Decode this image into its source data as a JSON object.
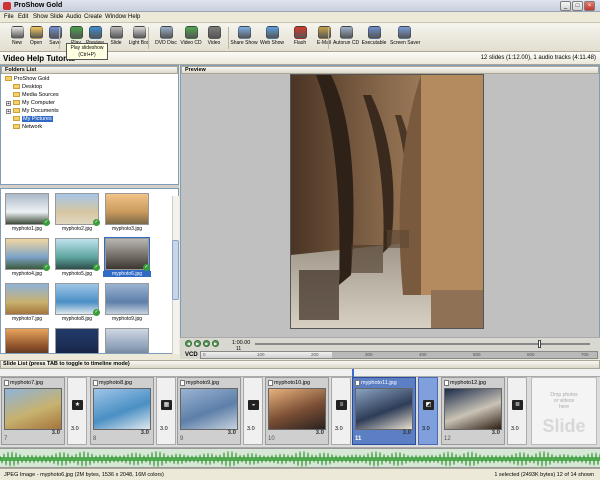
{
  "window": {
    "title": "ProShow Gold"
  },
  "menu": [
    "File",
    "Edit",
    "Show",
    "Slide",
    "Audio",
    "Create",
    "Window",
    "Help"
  ],
  "toolbar": [
    {
      "label": "New",
      "icon": "new-icon",
      "color": "#e8e8e8"
    },
    {
      "label": "Open",
      "icon": "open-icon",
      "color": "#f1c75b"
    },
    {
      "label": "Save",
      "icon": "save-icon",
      "color": "#6f8fcf"
    },
    {
      "label": "Play",
      "icon": "play-icon",
      "color": "#4aa14a"
    },
    {
      "label": "Preview",
      "icon": "preview-icon",
      "color": "#3d8ed1"
    },
    {
      "label": "Slide",
      "icon": "slide-icon",
      "color": "#bbbbbb"
    },
    {
      "label": "Light Box",
      "icon": "lightbox-icon",
      "color": "#d9d9d9"
    },
    {
      "label": "DVD Disc",
      "icon": "dvd-icon",
      "color": "#9cb0c8"
    },
    {
      "label": "Video CD",
      "icon": "vcd-icon",
      "color": "#4fa84f"
    },
    {
      "label": "Video",
      "icon": "video-icon",
      "color": "#7c7c7c"
    },
    {
      "label": "Share Show",
      "icon": "share-icon",
      "color": "#7fb0e6"
    },
    {
      "label": "Web Show",
      "icon": "web-icon",
      "color": "#5da0e0"
    },
    {
      "label": "Flash",
      "icon": "flash-icon",
      "color": "#d23b2b"
    },
    {
      "label": "E-Mail",
      "icon": "email-icon",
      "color": "#c8a24a"
    },
    {
      "label": "Autorun CD",
      "icon": "autorun-icon",
      "color": "#9cb0c8"
    },
    {
      "label": "Executable",
      "icon": "executable-icon",
      "color": "#6e8fcd"
    },
    {
      "label": "Screen Saver",
      "icon": "screensaver-icon",
      "color": "#7a9cd6"
    }
  ],
  "tooltip": {
    "line1": "Play slideshow",
    "line2": "(Ctrl+P)"
  },
  "project": {
    "title": "Video Help Tutorial",
    "info": "12 slides (1:12.00), 1 audio tracks (4:11.48)"
  },
  "folders": {
    "header": "Folders List",
    "items": [
      {
        "label": "ProShow Gold",
        "level": 0,
        "expander": ""
      },
      {
        "label": "Desktop",
        "level": 1,
        "expander": ""
      },
      {
        "label": "Media Sources",
        "level": 1,
        "expander": ""
      },
      {
        "label": "My Computer",
        "level": 1,
        "expander": "+"
      },
      {
        "label": "My Documents",
        "level": 1,
        "expander": "+"
      },
      {
        "label": "My Pictures",
        "level": 1,
        "expander": "",
        "selected": true
      },
      {
        "label": "Network",
        "level": 1,
        "expander": ""
      }
    ]
  },
  "thumbnails": [
    {
      "name": "myphoto1.jpg",
      "checked": true,
      "colors": [
        "#a9b8c9",
        "#eef2f5",
        "#3d4a3a"
      ]
    },
    {
      "name": "myphoto2.jpg",
      "checked": true,
      "colors": [
        "#a8c6e6",
        "#d6c6a3",
        "#e0d6c0"
      ]
    },
    {
      "name": "myphoto3.jpg",
      "checked": false,
      "colors": [
        "#f2c38a",
        "#c89a5b",
        "#7b6a4a"
      ]
    },
    {
      "name": "myphoto4.jpg",
      "checked": true,
      "colors": [
        "#f2d7a0",
        "#7da3c9",
        "#3c5a3c"
      ]
    },
    {
      "name": "myphoto5.jpg",
      "checked": true,
      "colors": [
        "#bfe2ef",
        "#5fa6a0",
        "#2d4d4a"
      ]
    },
    {
      "name": "myphoto6.jpg",
      "checked": true,
      "colors": [
        "#b8b6b0",
        "#6f6a63",
        "#3b3631"
      ],
      "selected": true
    },
    {
      "name": "myphoto7.jpg",
      "checked": false,
      "colors": [
        "#8fb3d9",
        "#c8b26f",
        "#a3753c"
      ]
    },
    {
      "name": "myphoto8.jpg",
      "checked": true,
      "colors": [
        "#9fc5e8",
        "#4a8fc4",
        "#e0e9ee"
      ]
    },
    {
      "name": "myphoto9.jpg",
      "checked": false,
      "colors": [
        "#9ab3d2",
        "#5d7fa9",
        "#c7d2de"
      ]
    },
    {
      "name": "",
      "checked": false,
      "colors": [
        "#e8a55c",
        "#8a4f2a",
        "#3a2a1a"
      ]
    },
    {
      "name": "",
      "checked": false,
      "colors": [
        "#223a6a",
        "#1c2d54",
        "#0f1a33"
      ]
    },
    {
      "name": "",
      "checked": false,
      "colors": [
        "#cfd7e3",
        "#8ea2b9",
        "#5c6f86"
      ]
    }
  ],
  "preview": {
    "header": "Preview"
  },
  "controls": {
    "time_start": "1:00.00",
    "time_index": "11",
    "vcd_label": "VCD",
    "ticks": [
      "0",
      "100",
      "200",
      "300",
      "400",
      "500",
      "600",
      "700"
    ],
    "progress": 0.33
  },
  "slide_list": {
    "header": "Slide List (press TAB to toggle to timeline mode)",
    "slides": [
      {
        "name": "myphoto7.jpg",
        "num": "7",
        "dur": "3.0",
        "colors": [
          "#8fb3d9",
          "#c8b26f",
          "#a3753c"
        ],
        "trans_dur": "3.0",
        "trans_glyph": "★"
      },
      {
        "name": "myphoto8.jpg",
        "num": "8",
        "dur": "3.0",
        "colors": [
          "#9fc5e8",
          "#4a8fc4",
          "#e0e9ee"
        ],
        "trans_dur": "3.0",
        "trans_glyph": "▦"
      },
      {
        "name": "myphoto9.jpg",
        "num": "9",
        "dur": "3.0",
        "colors": [
          "#9ab3d2",
          "#5d7fa9",
          "#c7d2de"
        ],
        "trans_dur": "3.0",
        "trans_glyph": "◒"
      },
      {
        "name": "myphoto10.jpg",
        "num": "10",
        "dur": "3.0",
        "colors": [
          "#e8b27d",
          "#7a4e34",
          "#2a2220"
        ],
        "trans_dur": "3.0",
        "trans_glyph": "≡"
      },
      {
        "name": "myphoto11.jpg",
        "num": "11",
        "dur": "3.0",
        "colors": [
          "#8aa3c2",
          "#2e3c57",
          "#e7e0cf"
        ],
        "selected": true,
        "trans_dur": "3.0",
        "trans_glyph": "◩"
      },
      {
        "name": "myphoto12.jpg",
        "num": "12",
        "dur": "3.0",
        "colors": [
          "#1c2b4a",
          "#c9c3b6",
          "#2d1e12"
        ],
        "trans_dur": "3.0",
        "trans_glyph": "≣"
      }
    ],
    "empty": {
      "line1": "Drop photos",
      "line2": "or videos",
      "line3": "here",
      "big": "Slide"
    }
  },
  "status": {
    "left": "JPEG Image - myphoto6.jpg  (2M bytes, 1536 x 2048, 16M colors)",
    "right": "1 selected (2493K bytes) 12 of 14 shown"
  }
}
